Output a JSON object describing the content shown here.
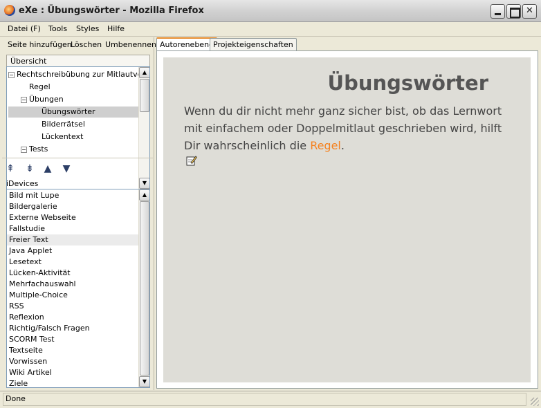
{
  "window": {
    "title": "eXe : Übungswörter - Mozilla Firefox",
    "icon": "firefox-icon"
  },
  "menu": {
    "items": [
      "Datei (F)",
      "Tools",
      "Styles",
      "Hilfe"
    ]
  },
  "outline_toolbar": {
    "add_label": "Seite hinzufügen",
    "delete_label": "Löschen",
    "rename_label": "Umbenennen"
  },
  "tree": {
    "header": "Übersicht",
    "nodes": [
      {
        "label": "Rechtschreibübung zur Mitlautve...",
        "level": 0,
        "expander": "minus"
      },
      {
        "label": "Regel",
        "level": 1,
        "expander": "none"
      },
      {
        "label": "Übungen",
        "level": 1,
        "expander": "minus"
      },
      {
        "label": "Übungswörter",
        "level": 2,
        "expander": "none",
        "selected": true
      },
      {
        "label": "Bilderrätsel",
        "level": 2,
        "expander": "none"
      },
      {
        "label": "Lückentext",
        "level": 2,
        "expander": "none"
      },
      {
        "label": "Tests",
        "level": 1,
        "expander": "minus"
      }
    ]
  },
  "nav_arrows": [
    "promote-icon",
    "demote-icon",
    "move-up-icon",
    "move-down-icon"
  ],
  "idevices": {
    "label": "iDevices",
    "items": [
      "Bild mit Lupe",
      "Bildergalerie",
      "Externe Webseite",
      "Fallstudie",
      "Freier Text",
      "Java Applet",
      "Lesetext",
      "Lücken-Aktivität",
      "Mehrfachauswahl",
      "Multiple-Choice",
      "RSS",
      "Reflexion",
      "Richtig/Falsch Fragen",
      "SCORM Test",
      "Textseite",
      "Vorwissen",
      "Wiki Artikel",
      "Ziele"
    ],
    "highlighted": "Freier Text"
  },
  "tabs": {
    "authoring": "Autorenebene",
    "properties": "Projekteigenschaften"
  },
  "content": {
    "heading": "Übungswörter",
    "text_before": "Wenn du dir nicht mehr ganz sicher bist, ob das Lernwort mit einfachem oder Doppelmitlaut geschrieben wird, hilft Dir wahrscheinlich die ",
    "link_text": "Regel",
    "text_after": ".",
    "link_color": "#f58220"
  },
  "status": {
    "text": "Done"
  }
}
